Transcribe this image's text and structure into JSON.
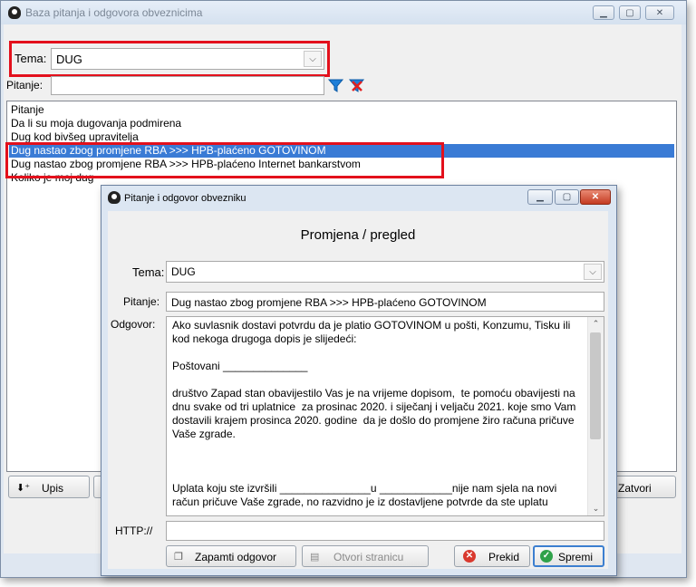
{
  "main": {
    "title": "Baza pitanja i odgovora obveznicima",
    "tema_label": "Tema:",
    "tema_value": "DUG",
    "pitanje_label": "Pitanje:",
    "pitanje_value": "",
    "list": {
      "header": "Pitanje",
      "items": [
        {
          "text": "Da li su moja dugovanja podmirena",
          "selected": false
        },
        {
          "text": "Dug kod bivšeg upravitelja",
          "selected": false
        },
        {
          "text": "Dug nastao zbog promjene RBA >>> HPB-plaćeno GOTOVINOM",
          "selected": true
        },
        {
          "text": "Dug nastao zbog promjene RBA >>> HPB-plaćeno Internet bankarstvom",
          "selected": false
        },
        {
          "text": "Koliko je moj dug",
          "selected": false
        }
      ]
    },
    "upis_label": "Upis",
    "zatvori_label": "Zatvori",
    "icons": {
      "filter": "filter-icon",
      "clear_filter": "clear-filter-icon"
    }
  },
  "dialog": {
    "title": "Pitanje i odgovor obvezniku",
    "heading": "Promjena / pregled",
    "tema_label": "Tema:",
    "tema_value": "DUG",
    "pitanje_label": "Pitanje:",
    "pitanje_value": "Dug nastao zbog promjene RBA >>> HPB-plaćeno GOTOVINOM",
    "odgovor_label": "Odgovor:",
    "odgovor_text": "Ako suvlasnik dostavi potvrdu da je platio GOTOVINOM u pošti, Konzumu, Tisku ili kod nekoga drugoga dopis je slijedeći:\n\nPoštovani ______________\n\ndruštvo Zapad stan obavijestilo Vas je na vrijeme dopisom,  te pomoću obavijesti na dnu svake od tri uplatnice  za prosinac 2020. i siječanj i veljaču 2021. koje smo Vam dostavili krajem prosinca 2020. godine  da je došlo do promjene žiro računa pričuve Vaše zgrade.\n\n\n\nUplata koju ste izvršili _______________u ____________nije nam sjela na novi račun pričuve Vaše zgrade, no razvidno je iz dostavljene potvrde da ste uplatu",
    "http_label": "HTTP://",
    "http_value": "",
    "buttons": {
      "zapamti": "Zapamti odgovor",
      "otvori": "Otvori stranicu",
      "prekid": "Prekid",
      "spremi": "Spremi"
    }
  },
  "colors": {
    "highlight_red": "#e3101c",
    "selection_blue": "#3a7bd5"
  }
}
